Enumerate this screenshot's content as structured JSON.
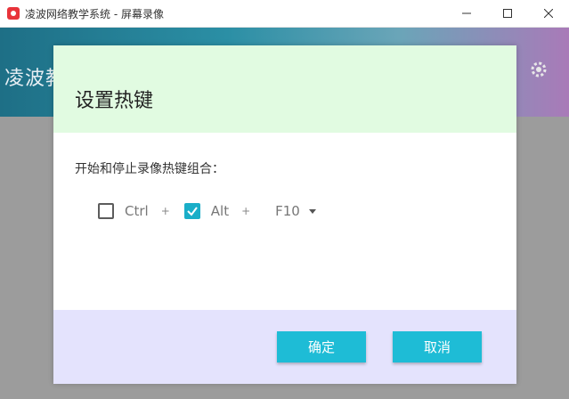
{
  "window": {
    "title": "凌波网络教学系统 - 屏幕录像"
  },
  "app": {
    "brand": "凌波教"
  },
  "dialog": {
    "title": "设置热键",
    "label": "开始和停止录像热键组合：",
    "keys": {
      "ctrl": {
        "label": "Ctrl",
        "checked": false
      },
      "alt": {
        "label": "Alt",
        "checked": true
      },
      "plus": "+",
      "fkey": "F10"
    },
    "ok_label": "确定",
    "cancel_label": "取消"
  },
  "colors": {
    "accent": "#1ebcd6",
    "header_bg": "#e1fbe1",
    "footer_bg": "#e4e3fd"
  }
}
